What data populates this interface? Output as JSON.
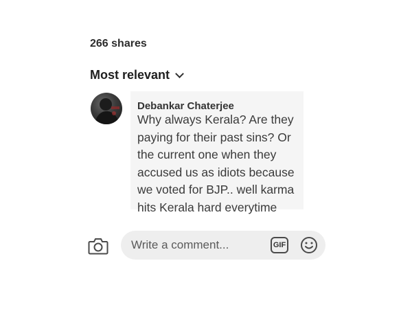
{
  "post": {
    "shares_label": "266 shares"
  },
  "comments_header": {
    "sort_label": "Most relevant",
    "sort_icon": "chevron-down-icon"
  },
  "comment": {
    "author": "Debankar Chaterjee",
    "text": "Why always Kerala?  Are they\npaying for their past sins?  Or\nthe current one when they\naccused us as idiots because\nwe voted for BJP..  well karma\nhits Kerala hard everytime",
    "avatar_icon": "avatar"
  },
  "composer": {
    "placeholder": "Write a comment...",
    "camera_icon": "camera-icon",
    "gif_label": "GIF",
    "emoji_icon": "emoji-icon"
  }
}
